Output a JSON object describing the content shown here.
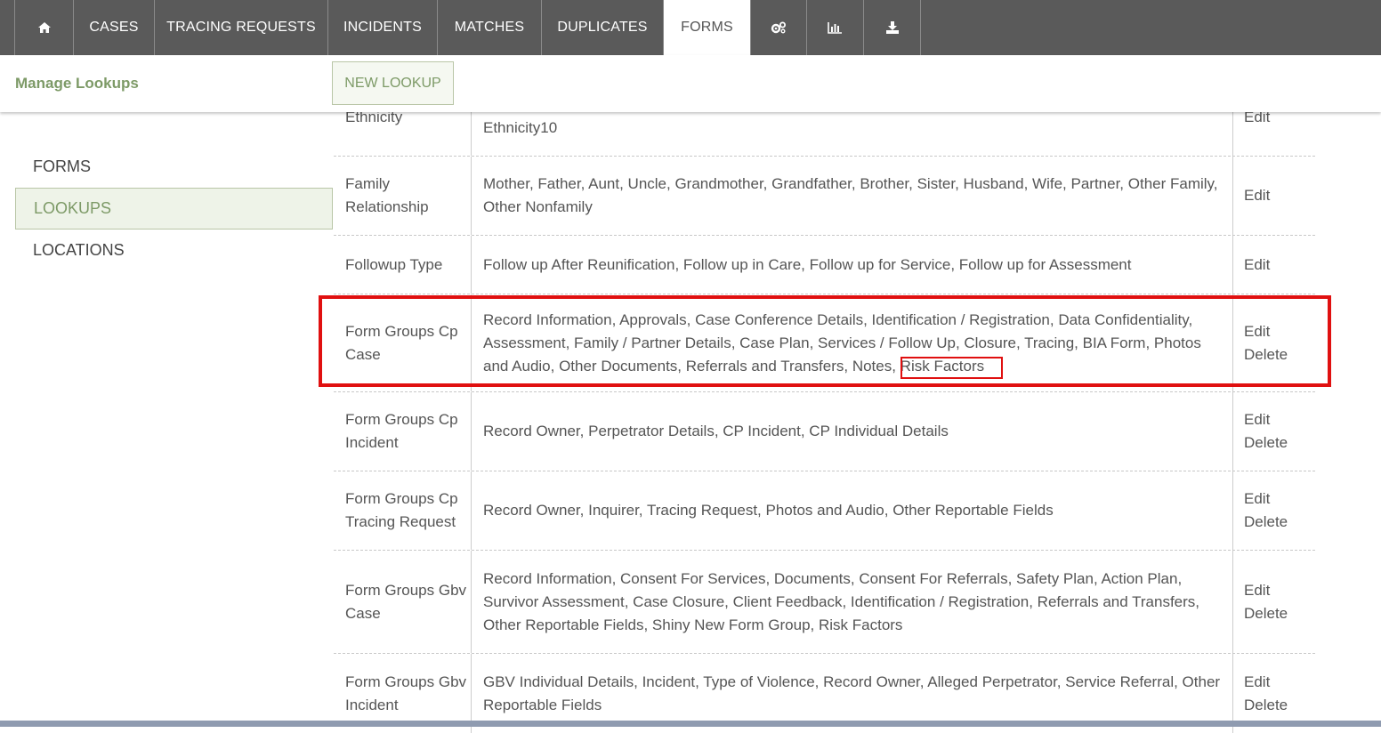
{
  "nav": {
    "home_icon": "home-icon",
    "items": [
      {
        "label": "CASES"
      },
      {
        "label": "TRACING REQUESTS"
      },
      {
        "label": "INCIDENTS"
      },
      {
        "label": "MATCHES"
      },
      {
        "label": "DUPLICATES"
      },
      {
        "label": "FORMS"
      }
    ],
    "icons": [
      "gears-icon",
      "bar-chart-icon",
      "download-icon"
    ]
  },
  "header": {
    "title": "Manage Lookups",
    "new_lookup_label": "NEW LOOKUP"
  },
  "sidebar": {
    "items": [
      {
        "label": "FORMS"
      },
      {
        "label": "LOOKUPS"
      },
      {
        "label": "LOCATIONS"
      }
    ]
  },
  "lookups": {
    "rows": [
      {
        "name": "Ethnicity",
        "values": "Ethnicity10",
        "actions": [
          "Edit"
        ]
      },
      {
        "name": "Family Relationship",
        "values": "Mother, Father, Aunt, Uncle, Grandmother, Grandfather, Brother, Sister, Husband, Wife, Partner, Other Family, Other Nonfamily",
        "actions": [
          "Edit"
        ]
      },
      {
        "name": "Followup Type",
        "values": "Follow up After Reunification, Follow up in Care, Follow up for Service, Follow up for Assessment",
        "actions": [
          "Edit"
        ]
      },
      {
        "name": "Form Groups Cp Case",
        "values": "Record Information, Approvals, Case Conference Details, Identification / Registration, Data Confidentiality, Assessment, Family / Partner Details, Case Plan, Services / Follow Up, Closure, Tracing, BIA Form, Photos and Audio, Other Documents, Referrals and Transfers, Notes,",
        "values_highlight": " Risk Factors",
        "actions": [
          "Edit",
          "Delete"
        ]
      },
      {
        "name": "Form Groups Cp Incident",
        "values": "Record Owner, Perpetrator Details, CP Incident, CP Individual Details",
        "actions": [
          "Edit",
          "Delete"
        ]
      },
      {
        "name": "Form Groups Cp Tracing Request",
        "values": "Record Owner, Inquirer, Tracing Request, Photos and Audio, Other Reportable Fields",
        "actions": [
          "Edit",
          "Delete"
        ]
      },
      {
        "name": "Form Groups Gbv Case",
        "values": "Record Information, Consent For Services, Documents, Consent For Referrals, Safety Plan, Action Plan, Survivor Assessment, Case Closure, Client Feedback, Identification / Registration, Referrals and Transfers, Other Reportable Fields, Shiny New Form Group, Risk Factors",
        "actions": [
          "Edit",
          "Delete"
        ]
      },
      {
        "name": "Form Groups Gbv Incident",
        "values": "GBV Individual Details, Incident, Type of Violence, Record Owner, Alleged Perpetrator, Service Referral, Other Reportable Fields",
        "actions": [
          "Edit",
          "Delete"
        ]
      }
    ]
  },
  "colors": {
    "nav_bg": "#5a5a5a",
    "accent_green": "#7d9a67",
    "highlight_red": "#e01010"
  }
}
